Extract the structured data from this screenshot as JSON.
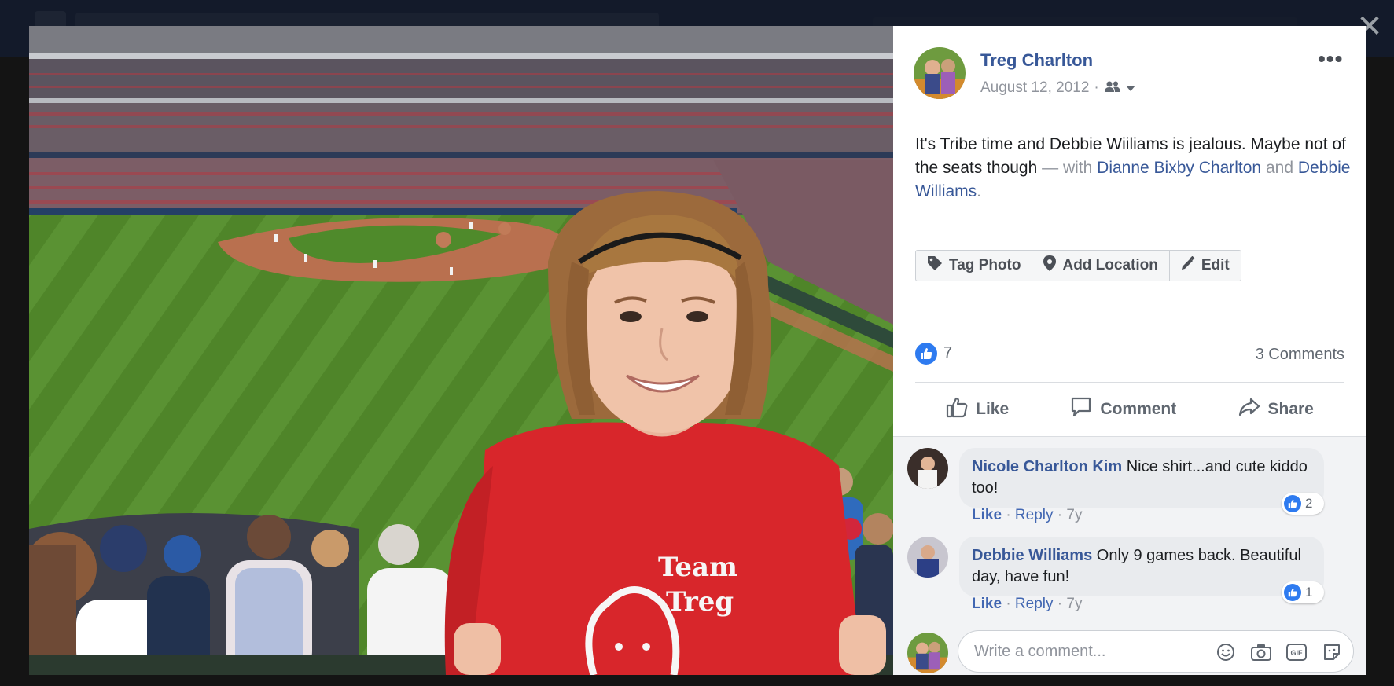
{
  "post": {
    "author_name": "Treg Charlton",
    "date": "August 12, 2012",
    "privacy_icon": "friends-icon",
    "more_label": "•••",
    "caption": {
      "text": "It's Tribe time and Debbie Wiiliams is jealous. Maybe not of the seats though",
      "with_sep": "— with",
      "tag1": "Dianne Bixby Charlton",
      "and": "and",
      "tag2": "Debbie Williams",
      "end": "."
    },
    "photo_actions": [
      {
        "label": "Tag Photo",
        "icon": "tag-icon"
      },
      {
        "label": "Add Location",
        "icon": "location-pin-icon"
      },
      {
        "label": "Edit",
        "icon": "pencil-icon"
      }
    ],
    "reaction_count": "7",
    "comments_count": "3 Comments",
    "buttons": {
      "like": "Like",
      "comment": "Comment",
      "share": "Share"
    }
  },
  "shirt_text": {
    "line1": "Team",
    "line2": "Treg"
  },
  "comments": [
    {
      "name": "Nicole Charlton Kim",
      "text": "Nice shirt...and cute kiddo too!",
      "like": "Like",
      "reply": "Reply",
      "sep": "·",
      "age": "7y",
      "reactions": "2"
    },
    {
      "name": "Debbie Williams",
      "text": "Only 9 games back. Beautiful day, have fun!",
      "like": "Like",
      "reply": "Reply",
      "sep": "·",
      "age": "7y",
      "reactions": "1"
    }
  ],
  "write_comment": {
    "placeholder": "Write a comment..."
  },
  "close_label": "✕",
  "colors": {
    "link": "#385898",
    "like_blue": "#2e7bf0",
    "shirt_red": "#d8262b"
  }
}
